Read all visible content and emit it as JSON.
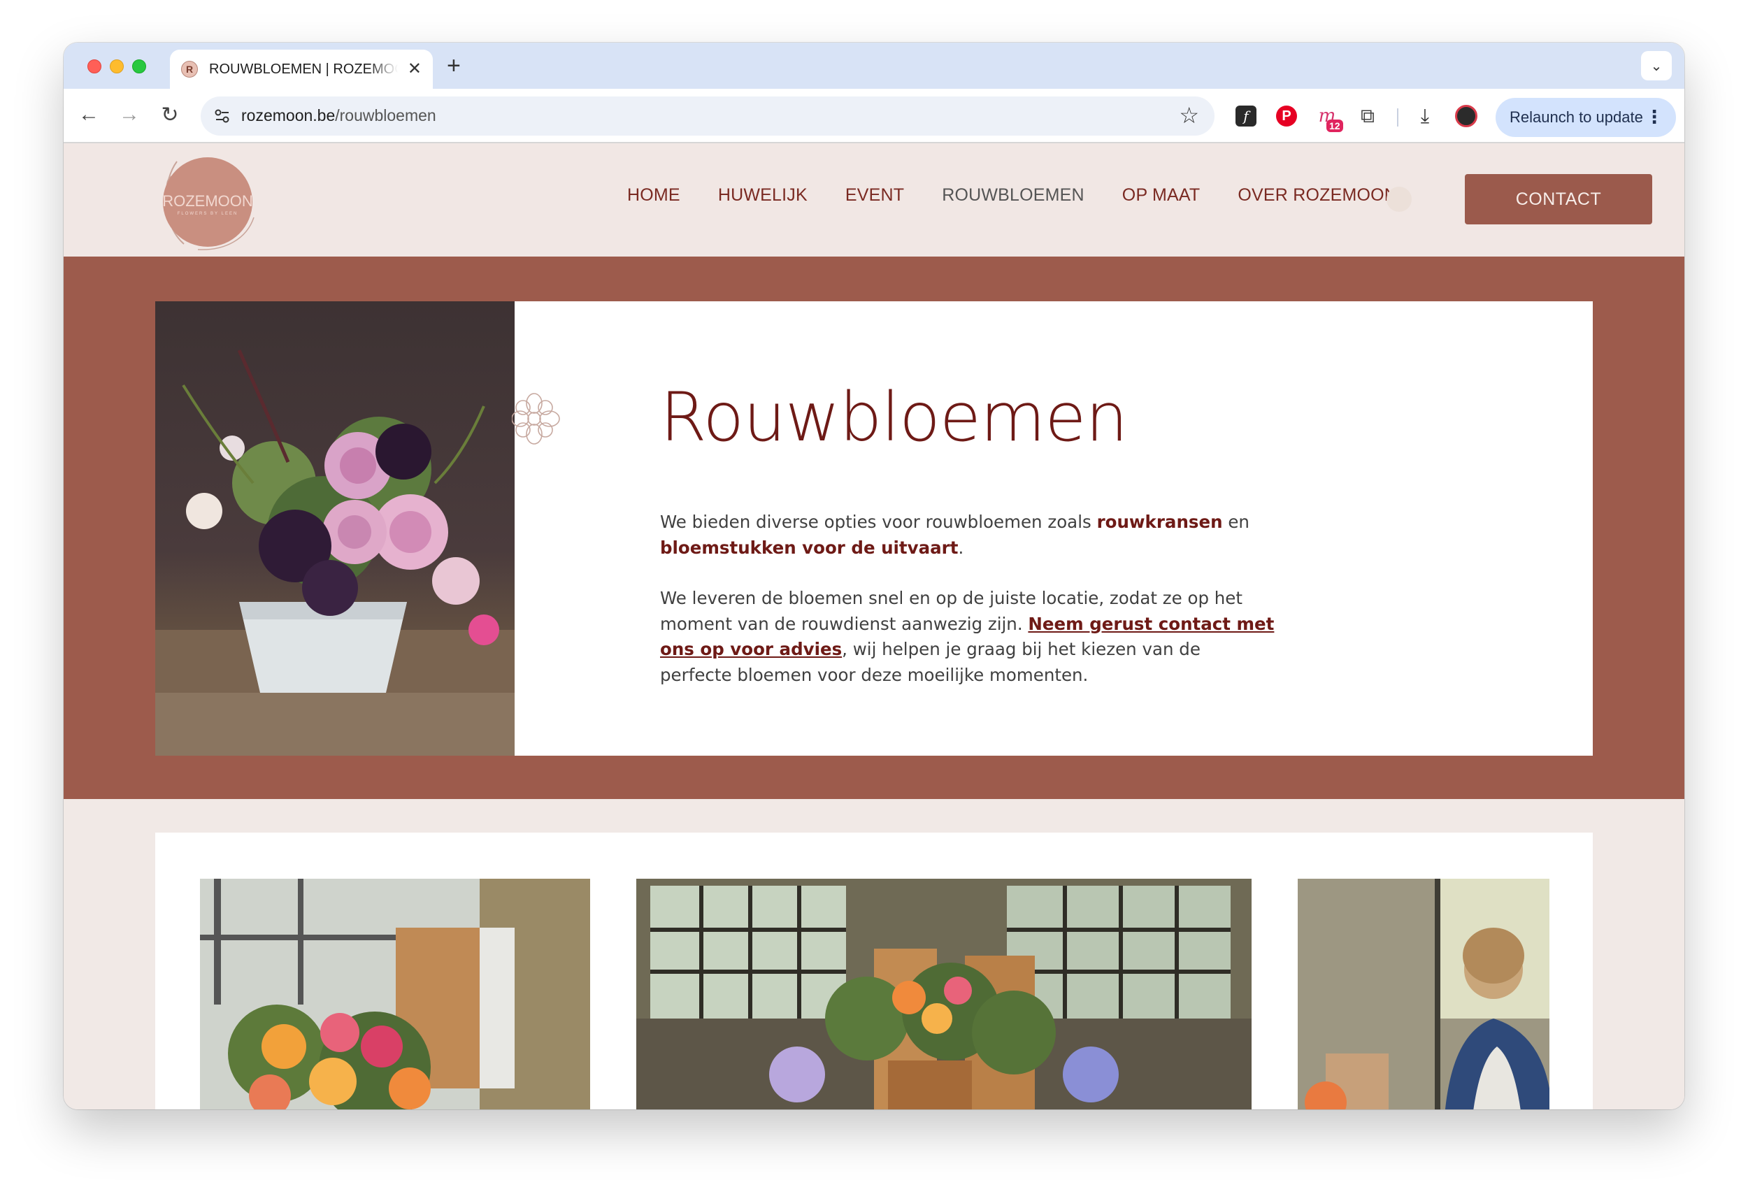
{
  "browser": {
    "tab_title": "ROUWBLOEMEN | ROZEMOON",
    "tab_favicon_letter": "R",
    "url_domain": "rozemoon.be",
    "url_path": "/rouwbloemen",
    "extension_badge": "12",
    "relaunch_label": "Relaunch to update"
  },
  "site": {
    "logo_text": "ROZEMOON",
    "logo_subtext": "FLOWERS BY LEEN",
    "nav": [
      {
        "label": "HOME",
        "active": false
      },
      {
        "label": "HUWELIJK",
        "active": false
      },
      {
        "label": "EVENT",
        "active": false
      },
      {
        "label": "ROUWBLOEMEN",
        "active": true
      },
      {
        "label": "OP MAAT",
        "active": false
      },
      {
        "label": "OVER ROZEMOON",
        "active": false
      }
    ],
    "contact_label": "CONTACT"
  },
  "hero": {
    "title": "Rouwbloemen",
    "p1_before": "We  bieden diverse opties voor rouwbloemen zoals ",
    "p1_link1": "rouwkransen",
    "p1_mid": " en ",
    "p1_link2": "bloemstukken voor de uitvaart",
    "p1_end": ".",
    "p2_before": "We leveren de bloemen snel en op de juiste locatie, zodat ze op het moment van de rouwdienst aanwezig zijn. ",
    "p2_link": "Neem gerust contact met ons op voor advies",
    "p2_after": ", wij helpen je graag bij het kiezen van de perfecte bloemen voor deze moeilijke momenten."
  },
  "colors": {
    "brand_terracotta": "#9d5b4c",
    "brand_dark_red": "#6e1a16",
    "header_bg": "#f1e7e4",
    "tab_strip": "#d8e3f6",
    "relaunch_bg": "#d3e3fd"
  }
}
